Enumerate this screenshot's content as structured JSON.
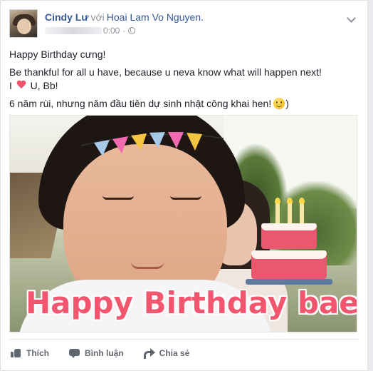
{
  "post": {
    "author": "Cindy Lư",
    "with_word": "với",
    "tagged": "Hoai Lam Vo Nguyen.",
    "timestamp": "0:00",
    "separator": "·"
  },
  "message": {
    "line1": "Happy Birthday cưng!",
    "line2": "Be thankful for all u have, because u neva know what will happen next!",
    "line3_prefix": "I",
    "line3_suffix": "U, Bb!",
    "line4": "6 năm rùi, nhưng năm đầu tiên dự sinh nhật công khai hen!",
    "line4_end": ")"
  },
  "photo": {
    "caption": "Happy Birthday bae!"
  },
  "actions": {
    "like": "Thích",
    "comment": "Bình luận",
    "share": "Chia sẻ"
  },
  "icons": [
    "chevron-down-icon",
    "globe-icon",
    "heart-icon",
    "smile-icon",
    "cake-icon",
    "like-icon",
    "comment-icon",
    "share-icon"
  ],
  "colors": {
    "link": "#365899",
    "muted": "#90949c",
    "heart": "#f25268",
    "caption": "#f2566e",
    "action": "#616770"
  }
}
